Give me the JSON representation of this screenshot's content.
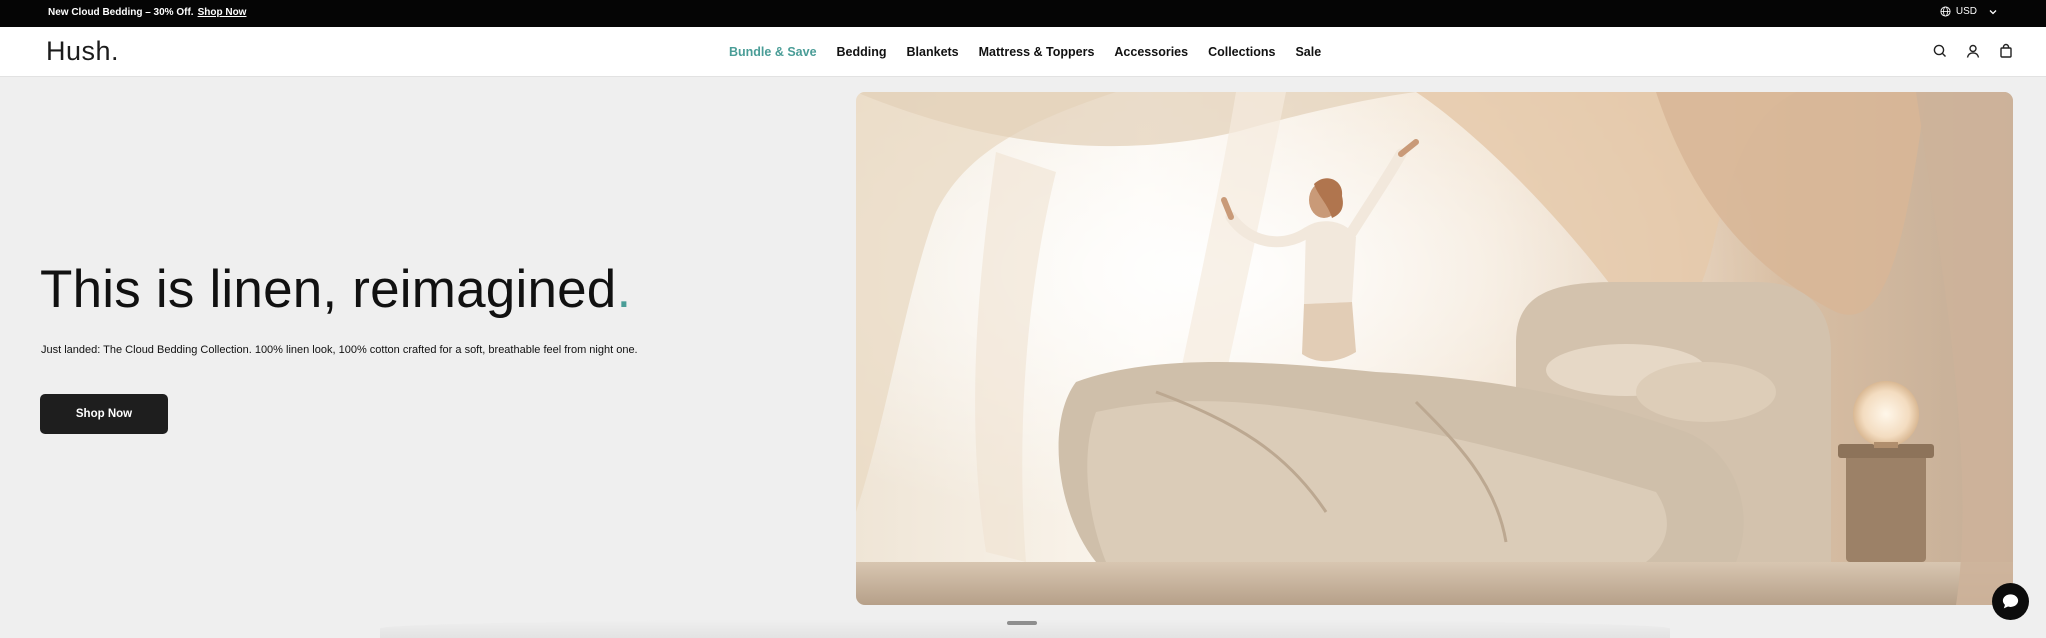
{
  "announcement": {
    "promo_text": "New Cloud Bedding – 30% Off.",
    "promo_link": "Shop Now",
    "currency_icon": "globe-icon",
    "currency": "USD",
    "currency_chevron": "chevron-down-icon"
  },
  "header": {
    "logo": "Hush.",
    "nav": [
      {
        "label": "Bundle & Save",
        "accent": true
      },
      {
        "label": "Bedding"
      },
      {
        "label": "Blankets"
      },
      {
        "label": "Mattress & Toppers"
      },
      {
        "label": "Accessories"
      },
      {
        "label": "Collections"
      },
      {
        "label": "Sale"
      }
    ],
    "icons": [
      "search-icon",
      "account-icon",
      "cart-icon"
    ]
  },
  "hero": {
    "title_main": "This is linen, reimagined",
    "title_dot": ".",
    "subtitle": "Just landed: The Cloud Bedding Collection. 100% linen look, 100% cotton crafted for a soft, breathable feel from night one.",
    "cta": "Shop Now",
    "image": "woman stretching beside bed with linen canopy"
  },
  "widgets": {
    "chat_icon": "chat-icon"
  },
  "colors": {
    "accent": "#4a9d97",
    "announcement_bg": "#050505",
    "hero_bg": "#efefef",
    "button_bg": "#1e1e1e"
  }
}
